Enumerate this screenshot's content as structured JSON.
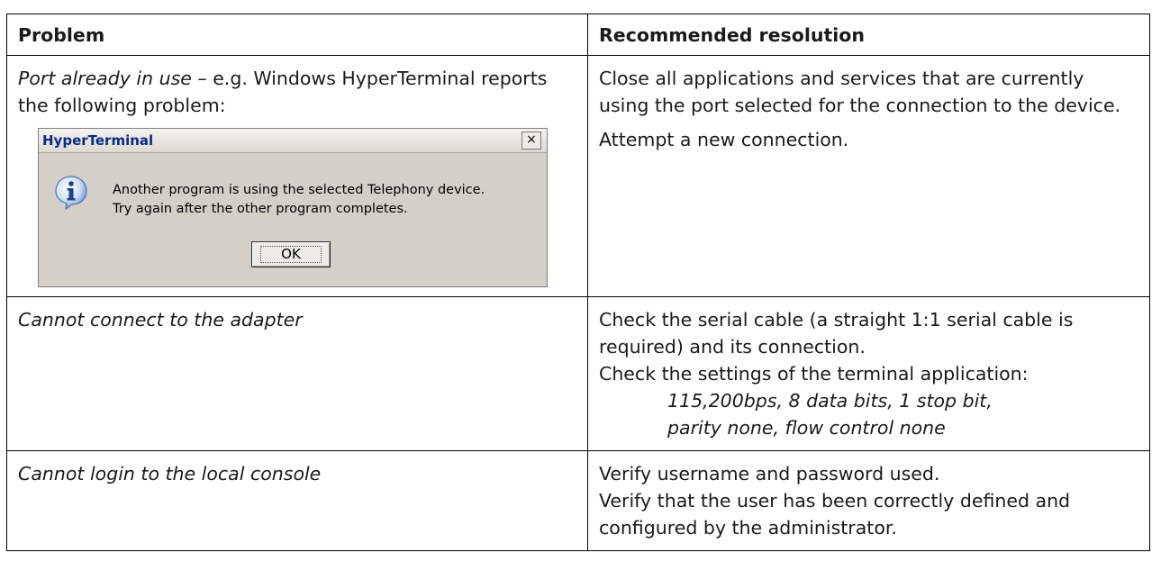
{
  "table": {
    "header_problem": "Problem",
    "header_resolution": "Recommended resolution",
    "row1": {
      "problem_italic": "Port already in use",
      "problem_rest": " – e.g. Windows HyperTerminal reports the following problem:",
      "resolution_p1": "Close all applications and services that are currently using the port selected for the connection to the device.",
      "resolution_p2": "Attempt a new connection."
    },
    "row2": {
      "problem": "Cannot connect to the adapter",
      "resolution_line1": "Check the serial cable (a straight 1:1 serial cable is required) and its connection.",
      "resolution_line2": "Check the settings of the terminal application:",
      "settings_line1": "115,200bps, 8 data bits, 1 stop bit,",
      "settings_line2": "parity none, flow control none"
    },
    "row3": {
      "problem": "Cannot login to the local console",
      "resolution_line1": "Verify username and password used.",
      "resolution_line2": "Verify that the user has been correctly defined and configured by the administrator."
    }
  },
  "dialog": {
    "title": "HyperTerminal",
    "close_glyph": "×",
    "message_line1": "Another program is using the selected Telephony device.",
    "message_line2": "Try again after the other program completes.",
    "ok_label": "OK",
    "icon": "info-icon"
  }
}
